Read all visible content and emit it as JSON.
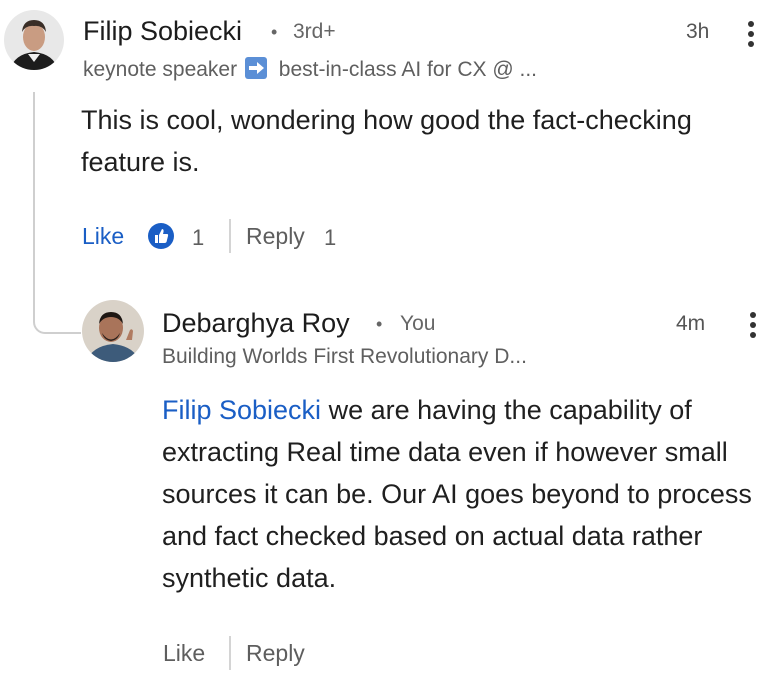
{
  "comment": {
    "author": "Filip Sobiecki",
    "degree": "3rd+",
    "time": "3h",
    "headline_part1": "keynote speaker",
    "headline_emoji": "right-arrow-emoji",
    "headline_part2": "best-in-class AI for CX @ ...",
    "text": "This is cool, wondering how good the fact-checking feature is.",
    "like_label": "Like",
    "like_count": "1",
    "reply_label": "Reply",
    "reply_count": "1",
    "like_icon_color": "#1a5ec5"
  },
  "reply": {
    "author": "Debarghya Roy",
    "relation": "You",
    "time": "4m",
    "headline": "Building Worlds First Revolutionary D...",
    "mention": "Filip Sobiecki",
    "text": "we are having the capability of extracting Real time data even if however small sources it can be. Our AI goes beyond to process and fact checked based on actual data rather synthetic data.",
    "like_label": "Like",
    "reply_label": "Reply"
  },
  "colors": {
    "link_blue": "#1a5ec5",
    "text_primary": "#1f1f1f",
    "text_secondary": "#5f5f5f"
  }
}
